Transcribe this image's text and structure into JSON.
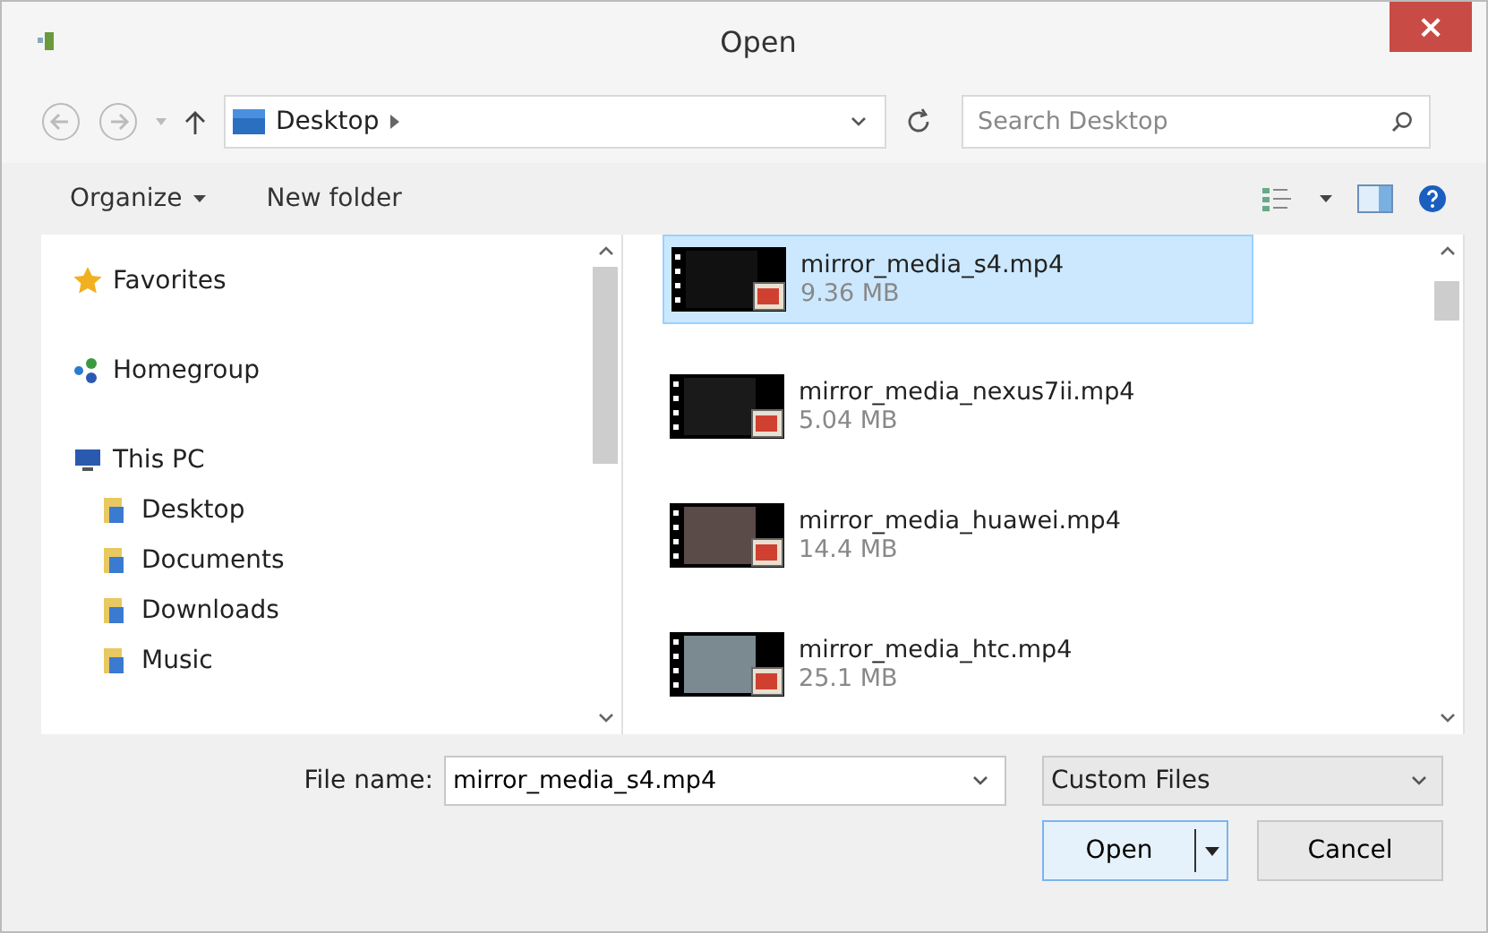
{
  "window": {
    "title": "Open",
    "close": "×"
  },
  "nav": {
    "location": "Desktop",
    "search": {
      "placeholder": "Search Desktop"
    }
  },
  "toolbar": {
    "organize": "Organize",
    "new_folder": "New folder"
  },
  "sidebar": {
    "items": [
      {
        "label": "Favorites",
        "kind": "star"
      },
      {
        "label": "Homegroup",
        "kind": "homegroup"
      },
      {
        "label": "This PC",
        "kind": "pc",
        "children": [
          {
            "label": "Desktop",
            "kind": "folder"
          },
          {
            "label": "Documents",
            "kind": "folder"
          },
          {
            "label": "Downloads",
            "kind": "folder"
          },
          {
            "label": "Music",
            "kind": "folder"
          }
        ]
      }
    ]
  },
  "files": [
    {
      "name": "mirror_media_s4.mp4",
      "size": "9.36 MB",
      "selected": true
    },
    {
      "name": "mirror_media_nexus7ii.mp4",
      "size": "5.04 MB",
      "selected": false
    },
    {
      "name": "mirror_media_huawei.mp4",
      "size": "14.4 MB",
      "selected": false
    },
    {
      "name": "mirror_media_htc.mp4",
      "size": "25.1 MB",
      "selected": false
    }
  ],
  "footer": {
    "file_name_label": "File name:",
    "file_name": "mirror_media_s4.mp4",
    "file_type": "Custom Files",
    "open": "Open",
    "cancel": "Cancel"
  }
}
